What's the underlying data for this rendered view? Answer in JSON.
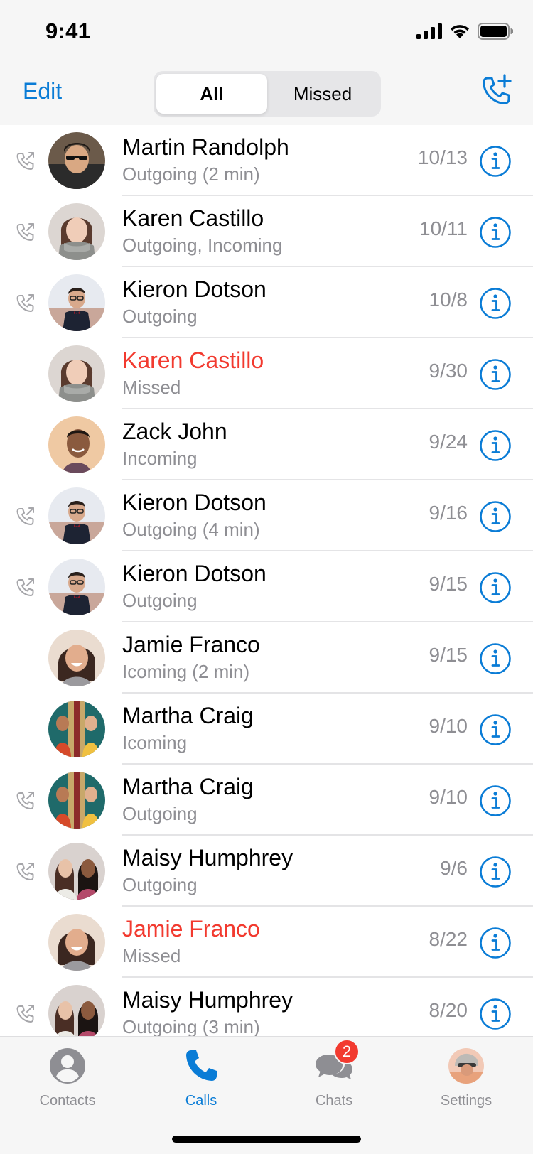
{
  "status_bar": {
    "time": "9:41"
  },
  "nav": {
    "edit_label": "Edit",
    "segments": [
      {
        "label": "All",
        "active": true
      },
      {
        "label": "Missed",
        "active": false
      }
    ],
    "new_call_icon": "phone-plus-icon"
  },
  "calls": [
    {
      "name": "Martin Randolph",
      "detail": "Outgoing (2 min)",
      "date": "10/13",
      "missed": false,
      "outgoing_icon": true,
      "avatar": "man-sunglasses"
    },
    {
      "name": "Karen Castillo",
      "detail": "Outgoing, Incoming",
      "date": "10/11",
      "missed": false,
      "outgoing_icon": true,
      "avatar": "woman-scarf"
    },
    {
      "name": "Kieron Dotson",
      "detail": "Outgoing",
      "date": "10/8",
      "missed": false,
      "outgoing_icon": true,
      "avatar": "man-suit"
    },
    {
      "name": "Karen Castillo",
      "detail": "Missed",
      "date": "9/30",
      "missed": true,
      "outgoing_icon": false,
      "avatar": "woman-scarf"
    },
    {
      "name": "Zack John",
      "detail": "Incoming",
      "date": "9/24",
      "missed": false,
      "outgoing_icon": false,
      "avatar": "man-smile"
    },
    {
      "name": "Kieron Dotson",
      "detail": "Outgoing (4 min)",
      "date": "9/16",
      "missed": false,
      "outgoing_icon": true,
      "avatar": "man-suit"
    },
    {
      "name": "Kieron Dotson",
      "detail": "Outgoing",
      "date": "9/15",
      "missed": false,
      "outgoing_icon": true,
      "avatar": "man-suit"
    },
    {
      "name": "Jamie Franco",
      "detail": "Icoming (2 min)",
      "date": "9/15",
      "missed": false,
      "outgoing_icon": false,
      "avatar": "woman-laugh"
    },
    {
      "name": "Martha Craig",
      "detail": "Icoming",
      "date": "9/10",
      "missed": false,
      "outgoing_icon": false,
      "avatar": "women-colorful"
    },
    {
      "name": "Martha Craig",
      "detail": "Outgoing",
      "date": "9/10",
      "missed": false,
      "outgoing_icon": true,
      "avatar": "women-colorful"
    },
    {
      "name": "Maisy Humphrey",
      "detail": "Outgoing",
      "date": "9/6",
      "missed": false,
      "outgoing_icon": true,
      "avatar": "two-women"
    },
    {
      "name": "Jamie Franco",
      "detail": "Missed",
      "date": "8/22",
      "missed": true,
      "outgoing_icon": false,
      "avatar": "woman-laugh"
    },
    {
      "name": "Maisy Humphrey",
      "detail": "Outgoing (3 min)",
      "date": "8/20",
      "missed": false,
      "outgoing_icon": true,
      "avatar": "two-women"
    }
  ],
  "tabs": [
    {
      "label": "Contacts",
      "icon": "person-circle-icon",
      "active": false
    },
    {
      "label": "Calls",
      "icon": "phone-icon",
      "active": true
    },
    {
      "label": "Chats",
      "icon": "chat-bubbles-icon",
      "active": false,
      "badge": "2"
    },
    {
      "label": "Settings",
      "icon": "profile-photo-icon",
      "active": false
    }
  ],
  "colors": {
    "accent": "#0a7cd6",
    "missed": "#f23a2f",
    "secondary_text": "#8e8e93"
  }
}
